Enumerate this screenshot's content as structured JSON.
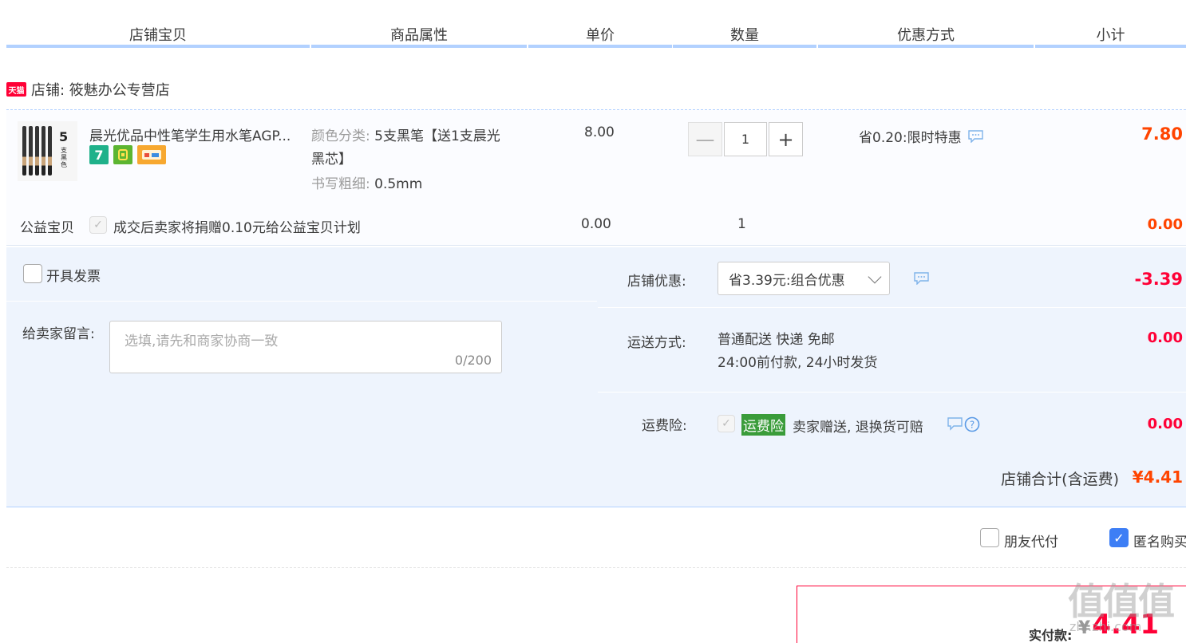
{
  "header": {
    "col_item": "店铺宝贝",
    "col_attr": "商品属性",
    "col_price": "单价",
    "col_qty": "数量",
    "col_discount": "优惠方式",
    "col_subtotal": "小计"
  },
  "shop": {
    "badge": "天猫",
    "name": "店铺: 筱魅办公专营店"
  },
  "item": {
    "thumb_num": "5",
    "thumb_sub": "支黑色",
    "title": "晨光优品中性笔学生用水笔AGP...",
    "icon_seven": "7",
    "attr1_key": "颜色分类:",
    "attr1_val": "5支黑笔【送1支晨光",
    "attr1_val2": "黑芯】",
    "attr2_key": "书写粗细:",
    "attr2_val": "0.5mm",
    "price": "8.00",
    "qty_minus": "—",
    "qty": "1",
    "qty_plus": "+",
    "discount": "省0.20:限时特惠",
    "subtotal": "7.80"
  },
  "charity": {
    "label": "公益宝贝",
    "text": "成交后卖家将捐赠0.10元给公益宝贝计划",
    "price": "0.00",
    "qty": "1",
    "subtotal": "0.00"
  },
  "invoice": {
    "label": "开具发票"
  },
  "memo": {
    "label": "给卖家留言:",
    "placeholder": "选填,请先和商家协商一致",
    "count": "0/200"
  },
  "shop_discount": {
    "label": "店铺优惠:",
    "value": "省3.39元:组合优惠",
    "amount": "-3.39"
  },
  "shipping": {
    "label": "运送方式:",
    "line1": "普通配送 快递 免邮",
    "line2": "24:00前付款, 24小时发货",
    "amount": "0.00"
  },
  "insurance": {
    "label": "运费险:",
    "tag": "运费险",
    "text": "卖家赠送, 退换货可赔",
    "amount": "0.00"
  },
  "total": {
    "label": "店铺合计(含运费)",
    "value": "¥4.41"
  },
  "options": {
    "friend_pay": "朋友代付",
    "anonymous": "匿名购买"
  },
  "pay": {
    "label": "实付款:",
    "currency": "¥",
    "value": "4.41"
  },
  "watermark": {
    "big": "值值值",
    "small": "zhi.zhi.com"
  },
  "colors": {
    "accent": "#b2d1ff",
    "price_red": "#ff4400",
    "tmall_red": "#ff0036",
    "checkbox_blue": "#3d7ef5",
    "insurance_green": "#3a9c3a"
  }
}
